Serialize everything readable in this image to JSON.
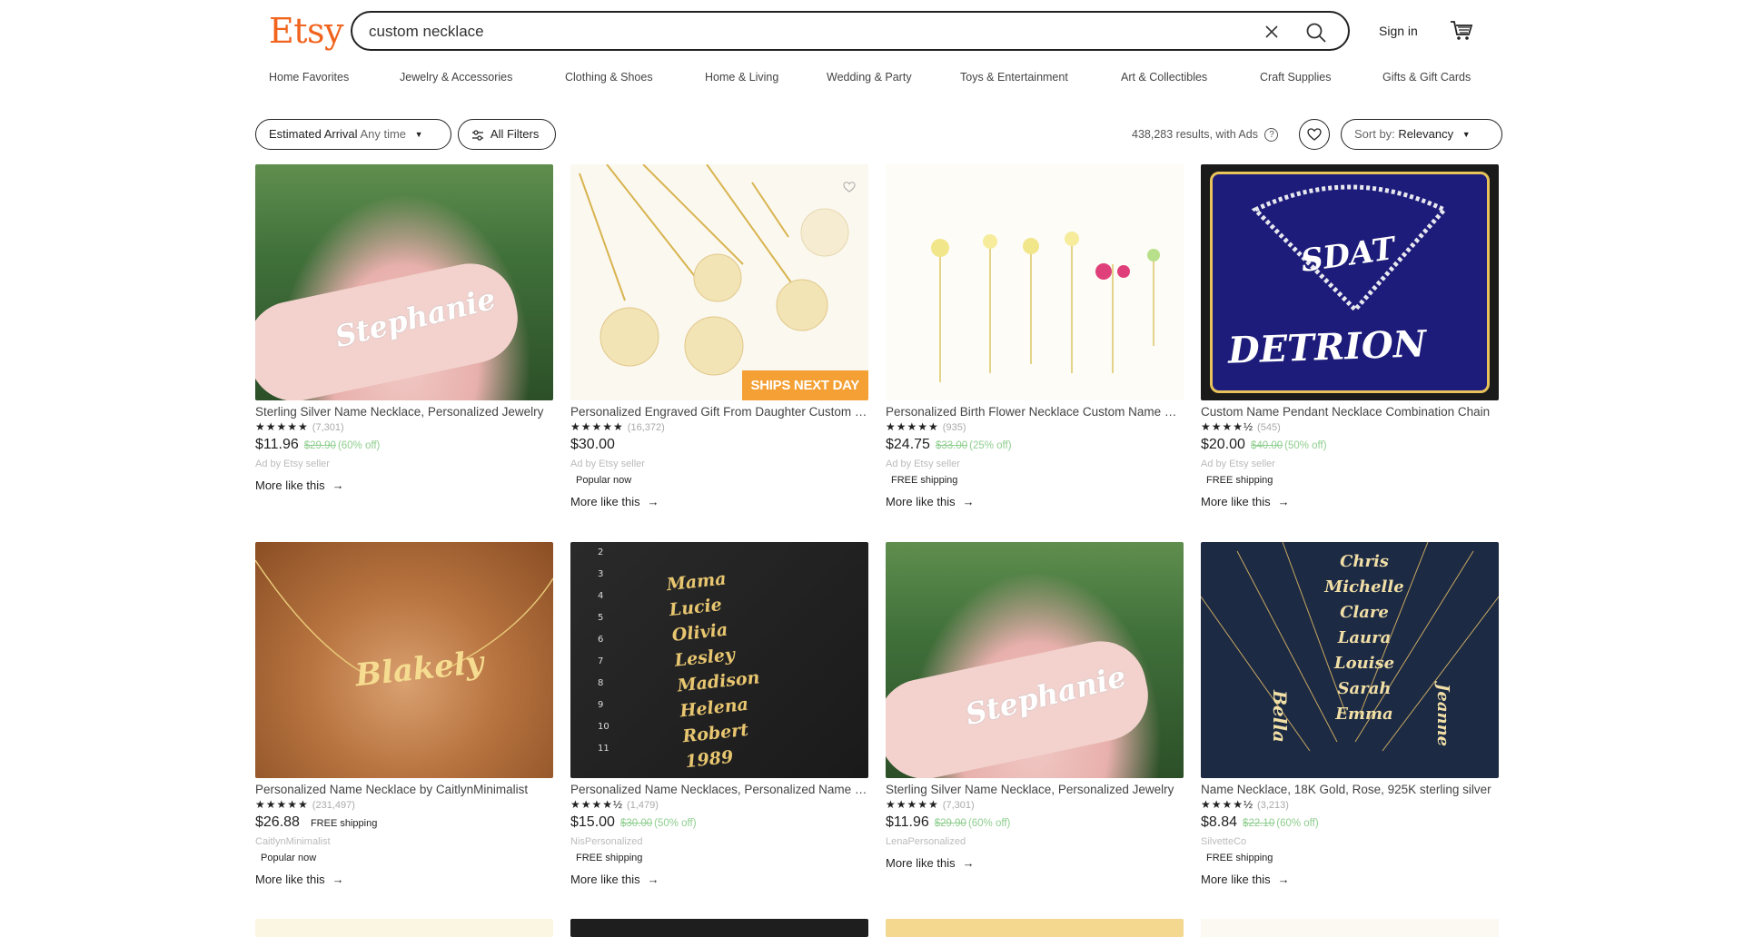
{
  "header": {
    "logo": "Etsy",
    "search_value": "custom necklace",
    "signin_label": "Sign in"
  },
  "categories": [
    "Home Favorites",
    "Jewelry & Accessories",
    "Clothing & Shoes",
    "Home & Living",
    "Wedding & Party",
    "Toys & Entertainment",
    "Art & Collectibles",
    "Craft Supplies",
    "Gifts & Gift Cards"
  ],
  "filters": {
    "arrival_label": "Estimated Arrival",
    "arrival_value": "Any time",
    "all_filters_label": "All Filters",
    "results_text": "438,283 results, with Ads",
    "sort_label": "Sort by:",
    "sort_value": "Relevancy"
  },
  "listings": [
    {
      "title": "Sterling Silver Name Necklace, Personalized Jewelry",
      "stars": "★★★★★",
      "reviews": "(7,301)",
      "price": "$11.96",
      "old_price": "$29.90",
      "discount": "(60% off)",
      "seller": "Ad by Etsy seller",
      "badge": "",
      "ship": "",
      "more": "More like this",
      "image_text": "Stephanie"
    },
    {
      "title": "Personalized Engraved Gift From Daughter Custom Necklace",
      "stars": "★★★★★",
      "reviews": "(16,372)",
      "price": "$30.00",
      "old_price": "",
      "discount": "",
      "seller": "Ad by Etsy seller",
      "badge": "Popular now",
      "ship": "",
      "more": "More like this",
      "image_text": "SHIPS NEXT DAY"
    },
    {
      "title": "Personalized Birth Flower Necklace Custom Name Necklace",
      "stars": "★★★★★",
      "reviews": "(935)",
      "price": "$24.75",
      "old_price": "$33.00",
      "discount": "(25% off)",
      "seller": "Ad by Etsy seller",
      "badge": "FREE shipping",
      "ship": "",
      "more": "More like this",
      "image_text": ""
    },
    {
      "title": "Custom Name Pendant Necklace Combination Chain",
      "stars": "★★★★½",
      "reviews": "(545)",
      "price": "$20.00",
      "old_price": "$40.00",
      "discount": "(50% off)",
      "seller": "Ad by Etsy seller",
      "badge": "FREE shipping",
      "ship": "",
      "more": "More like this",
      "image_text": "SDAT DETRION"
    },
    {
      "title": "Personalized Name Necklace by CaitlynMinimalist",
      "stars": "★★★★★",
      "reviews": "(231,497)",
      "price": "$26.88",
      "old_price": "",
      "discount": "",
      "seller": "CaitlynMinimalist",
      "badge": "Popular now",
      "ship": "FREE shipping",
      "more": "More like this",
      "image_text": "Blakely"
    },
    {
      "title": "Personalized Name Necklaces, Personalized Name Jewelry",
      "stars": "★★★★½",
      "reviews": "(1,479)",
      "price": "$15.00",
      "old_price": "$30.00",
      "discount": "(50% off)",
      "seller": "NisPersonalized",
      "badge": "FREE shipping",
      "ship": "",
      "more": "More like this",
      "image_text": "Mama Lucie Olivia Lesley Madison Helena Robert 1989"
    },
    {
      "title": "Sterling Silver Name Necklace, Personalized Jewelry",
      "stars": "★★★★★",
      "reviews": "(7,301)",
      "price": "$11.96",
      "old_price": "$29.90",
      "discount": "(60% off)",
      "seller": "LenaPersonalized",
      "badge": "",
      "ship": "",
      "more": "More like this",
      "image_text": "Stephanie"
    },
    {
      "title": "Name Necklace, 18K Gold, Rose, 925K sterling silver",
      "stars": "★★★★½",
      "reviews": "(3,213)",
      "price": "$8.84",
      "old_price": "$22.10",
      "discount": "(60% off)",
      "seller": "SilvetteCo",
      "badge": "FREE shipping",
      "ship": "",
      "more": "More like this",
      "image_text": "Chris Michelle Clare Laura Louise Sarah Emma Bella Jeanne"
    }
  ],
  "colors": {
    "brand": "#f1641e",
    "sale_green": "#8fce8f",
    "ships_badge": "#f4a034"
  }
}
